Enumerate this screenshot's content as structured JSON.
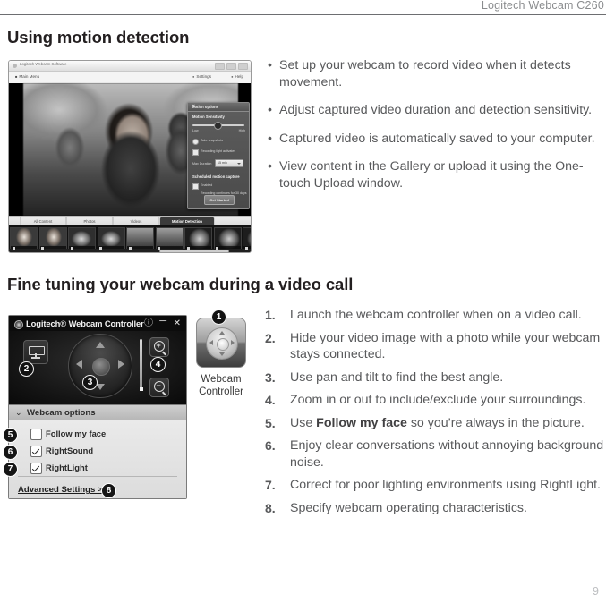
{
  "header": {
    "title": "Logitech  Webcam C260"
  },
  "sections": {
    "motion": {
      "heading": "Using motion detection",
      "bullets": [
        "Set up your webcam to record video when it detects movement.",
        "Adjust captured video duration and detection sensitivity.",
        "Captured video is automatically saved to your computer.",
        "View content in the Gallery or upload it using the One-touch Upload window."
      ],
      "bullet_glyph": "•"
    },
    "finetune": {
      "heading": "Fine tuning your webcam during a video call",
      "steps": [
        {
          "num": "1.",
          "text_before": "Launch the webcam controller when on a video call.",
          "bold": "",
          "text_after": ""
        },
        {
          "num": "2.",
          "text_before": "Hide your video image with a photo while your webcam stays connected.",
          "bold": "",
          "text_after": ""
        },
        {
          "num": "3.",
          "text_before": "Use pan and tilt to find the best angle.",
          "bold": "",
          "text_after": ""
        },
        {
          "num": "4.",
          "text_before": "Zoom in or out to include/exclude your surroundings.",
          "bold": "",
          "text_after": ""
        },
        {
          "num": "5.",
          "text_before": "Use ",
          "bold": "Follow my face",
          "text_after": " so you’re always in the picture."
        },
        {
          "num": "6.",
          "text_before": "Enjoy clear conversations without annoying background noise.",
          "bold": "",
          "text_after": ""
        },
        {
          "num": "7.",
          "text_before": "Correct for poor lighting environments using RightLight.",
          "bold": "",
          "text_after": ""
        },
        {
          "num": "8.",
          "text_before": "Specify webcam operating characteristics.",
          "bold": "",
          "text_after": ""
        }
      ]
    }
  },
  "app_screenshot": {
    "window_title": "Logitech Webcam Software",
    "main_menu_label": "Main Menu",
    "settings_label": "Settings",
    "help_label": "Help",
    "motion_panel": {
      "title": "Motion options",
      "close_glyph": "✕",
      "sensitivity_label": "Motion Sensitivity",
      "slider_low": "Low",
      "slider_high": "High",
      "option_1": "Take snapshots",
      "option_2": "Recording light activates",
      "duration_label": "Max Duration",
      "duration_value": "15 min",
      "saved_section_label": "Scheduled motion capture",
      "enable_label": "Enabled",
      "hint_text": "Recording continues for 30 days",
      "button_label": "Get Started"
    },
    "gallery_tabs": [
      {
        "label": "All Content",
        "active": false
      },
      {
        "label": "Photos",
        "active": false
      },
      {
        "label": "Videos",
        "active": false
      },
      {
        "label": "Motion Detection",
        "active": true
      }
    ]
  },
  "webcam_controller": {
    "title": "Logitech® Webcam Controller",
    "help_glyph": "?",
    "minimize_glyph": "–",
    "close_glyph": "✕",
    "options_header": "Webcam options",
    "options_chevron": "⌄",
    "options": [
      {
        "label": "Follow my face",
        "checked": false,
        "badge": "5"
      },
      {
        "label": "RightSound",
        "checked": true,
        "badge": "6"
      },
      {
        "label": "RightLight",
        "checked": true,
        "badge": "7"
      }
    ],
    "advanced_settings": "Advanced Settings >",
    "badges": {
      "photo_button": "2",
      "dpad": "3",
      "zoom": "4",
      "advanced": "8",
      "desktop_icon": "1"
    },
    "zoom_in_glyph": "+",
    "zoom_out_glyph": "−"
  },
  "desktop_icon": {
    "label_line1": "Webcam",
    "label_line2": "Controller"
  },
  "page_number": "9",
  "colors": {
    "text": "#58595b",
    "heading": "#231f20",
    "header_gray": "#8a8c8e",
    "rule": "#6d6e71",
    "page_number": "#bcbec0"
  }
}
